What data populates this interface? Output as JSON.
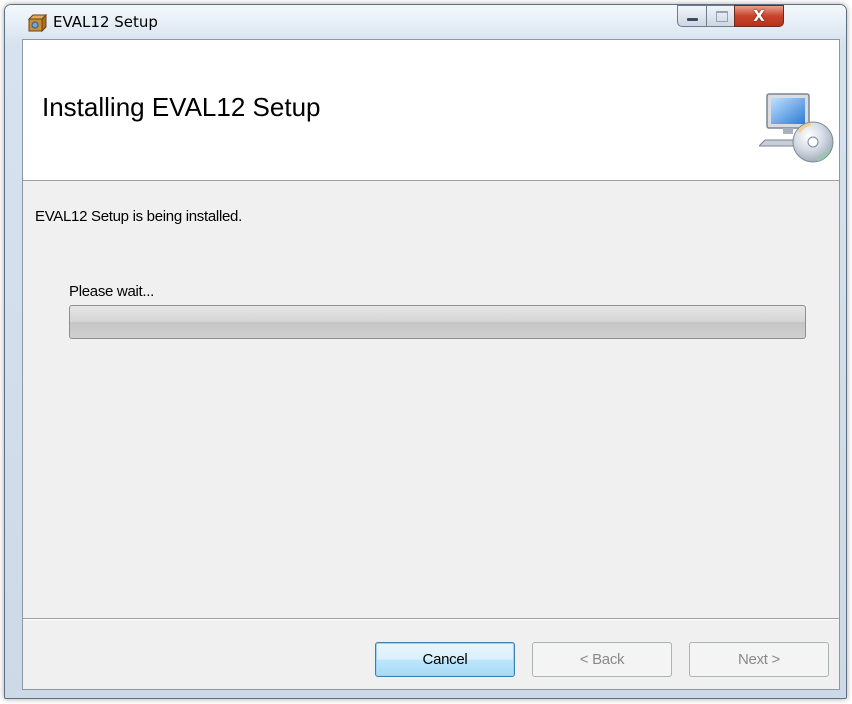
{
  "window": {
    "title": "EVAL12 Setup",
    "close_glyph": "X",
    "icons": {
      "app": "installer-box-icon",
      "minimize": "minimize-icon",
      "maximize": "maximize-icon",
      "close": "close-icon"
    }
  },
  "banner": {
    "title": "Installing EVAL12 Setup",
    "icon": "computer-with-cd-icon"
  },
  "body": {
    "status": "EVAL12 Setup is being installed.",
    "wait_label": "Please wait...",
    "progress": 0
  },
  "buttons": {
    "cancel": "Cancel",
    "back": "< Back",
    "next": "Next >"
  },
  "colors": {
    "accent_border": "#3c7fb1",
    "progress_fill": "#3cb321",
    "disabled_text": "#8a8a8a"
  }
}
